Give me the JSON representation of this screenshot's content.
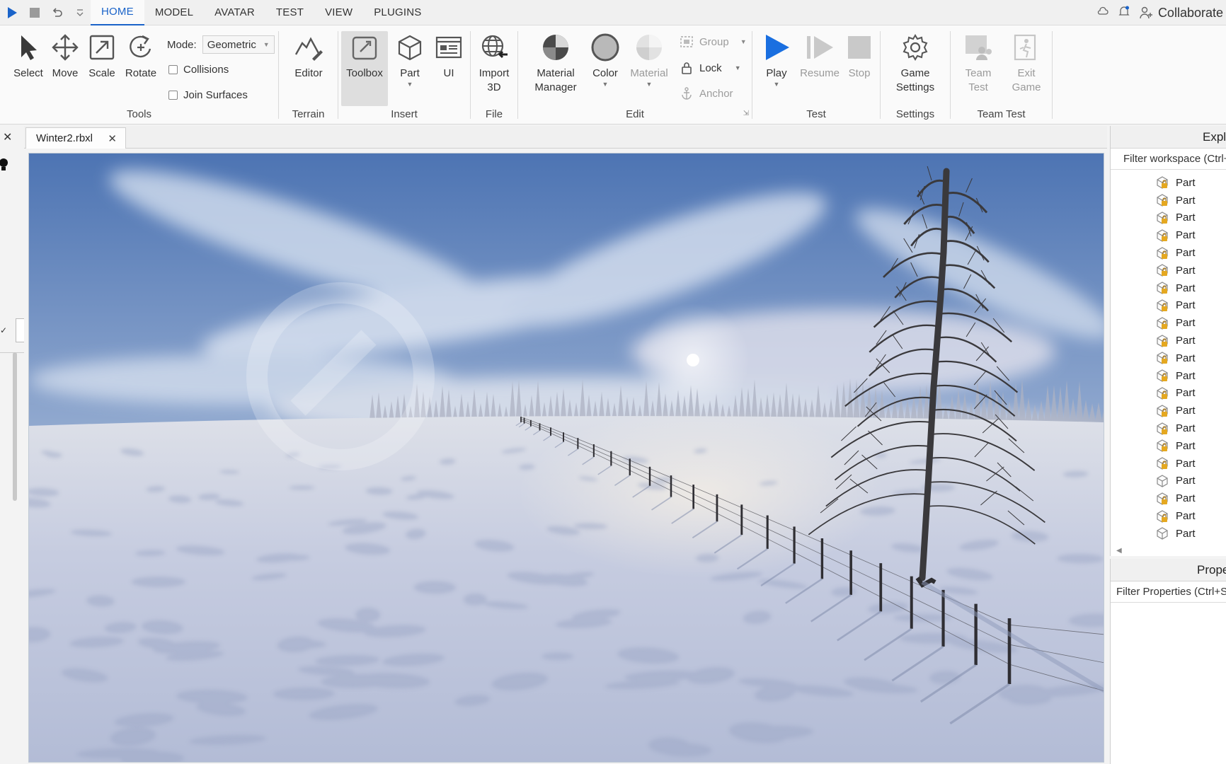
{
  "menubar": {
    "quick_access": [
      {
        "name": "play-icon",
        "color": "#1a63c9"
      },
      {
        "name": "stop-icon"
      },
      {
        "name": "undo-icon"
      },
      {
        "name": "customize-icon"
      }
    ],
    "tabs": [
      "HOME",
      "MODEL",
      "AVATAR",
      "TEST",
      "VIEW",
      "PLUGINS"
    ],
    "active_tab": "HOME",
    "collaborate_label": "Collaborate"
  },
  "ribbon": {
    "tools": {
      "label": "Tools",
      "select": "Select",
      "move": "Move",
      "scale": "Scale",
      "rotate": "Rotate",
      "mode_label": "Mode:",
      "mode_value": "Geometric",
      "collisions": "Collisions",
      "join_surfaces": "Join Surfaces"
    },
    "terrain": {
      "label": "Terrain",
      "editor": "Editor"
    },
    "insert": {
      "label": "Insert",
      "toolbox": "Toolbox",
      "part": "Part",
      "ui": "UI"
    },
    "file": {
      "label": "File",
      "import_line1": "Import",
      "import_line2": "3D"
    },
    "edit": {
      "label": "Edit",
      "material_manager_line1": "Material",
      "material_manager_line2": "Manager",
      "color": "Color",
      "material": "Material",
      "group": "Group",
      "lock": "Lock",
      "anchor": "Anchor"
    },
    "test": {
      "label": "Test",
      "play": "Play",
      "resume": "Resume",
      "stop": "Stop"
    },
    "settings": {
      "label": "Settings",
      "game_line1": "Game",
      "game_line2": "Settings"
    },
    "team_test": {
      "label": "Team Test",
      "team_line1": "Team",
      "team_line2": "Test",
      "exit_line1": "Exit",
      "exit_line2": "Game"
    }
  },
  "document": {
    "tab_name": "Winter2.rbxl"
  },
  "viewport": {
    "colors": {
      "sky_top": "#4f78b8",
      "sky_mid": "#9bb3d6",
      "horizon": "#d8dce6",
      "snow": "#c9cfe0",
      "snow_shadow": "#9ea9c6",
      "tree": "#3b3a3c"
    }
  },
  "explorer": {
    "title": "Explorer",
    "filter_placeholder": "Filter workspace (Ctrl+Shift+X)",
    "items": [
      {
        "label": "Part",
        "locked": true
      },
      {
        "label": "Part",
        "locked": true
      },
      {
        "label": "Part",
        "locked": true
      },
      {
        "label": "Part",
        "locked": true
      },
      {
        "label": "Part",
        "locked": true
      },
      {
        "label": "Part",
        "locked": true
      },
      {
        "label": "Part",
        "locked": true
      },
      {
        "label": "Part",
        "locked": true
      },
      {
        "label": "Part",
        "locked": true
      },
      {
        "label": "Part",
        "locked": true
      },
      {
        "label": "Part",
        "locked": true
      },
      {
        "label": "Part",
        "locked": true
      },
      {
        "label": "Part",
        "locked": true
      },
      {
        "label": "Part",
        "locked": true
      },
      {
        "label": "Part",
        "locked": true
      },
      {
        "label": "Part",
        "locked": true
      },
      {
        "label": "Part",
        "locked": true
      },
      {
        "label": "Part",
        "locked": false
      },
      {
        "label": "Part",
        "locked": true
      },
      {
        "label": "Part",
        "locked": true
      },
      {
        "label": "Part",
        "locked": false
      }
    ]
  },
  "properties": {
    "title": "Properties",
    "filter_placeholder": "Filter Properties (Ctrl+Shift+P)"
  }
}
